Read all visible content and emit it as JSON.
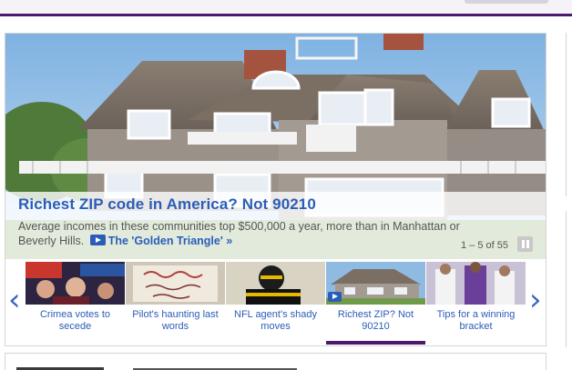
{
  "slideshow": {
    "headline": "Richest ZIP code in America? Not 90210",
    "summary": "Average incomes in these communities top $500,000 a year, more than in Manhattan or Beverly Hills.",
    "video_link": "The 'Golden Triangle' »",
    "counter": "1 – 5 of 55",
    "thumbnails": [
      {
        "label": "Crimea votes to secede",
        "image": "crowd-with-flags-photo"
      },
      {
        "label": "Pilot's haunting last words",
        "image": "handwritten-sign-photo"
      },
      {
        "label": "NFL agent's shady moves",
        "image": "football-player-photo"
      },
      {
        "label": "Richest ZIP? Not 90210",
        "image": "mansion-photo",
        "active": true,
        "has_video": true
      },
      {
        "label": "Tips for a winning bracket",
        "image": "basketball-players-photo"
      }
    ]
  },
  "icons": {
    "prev": "chevron-left-icon",
    "next": "chevron-right-icon",
    "play": "play-icon",
    "pause": "pause-icon"
  },
  "colors": {
    "link": "#2b5db8",
    "brand": "#4b1a6e",
    "caption_text": "#555555"
  },
  "glyphs": {
    "prev": "‹",
    "next": "›"
  }
}
